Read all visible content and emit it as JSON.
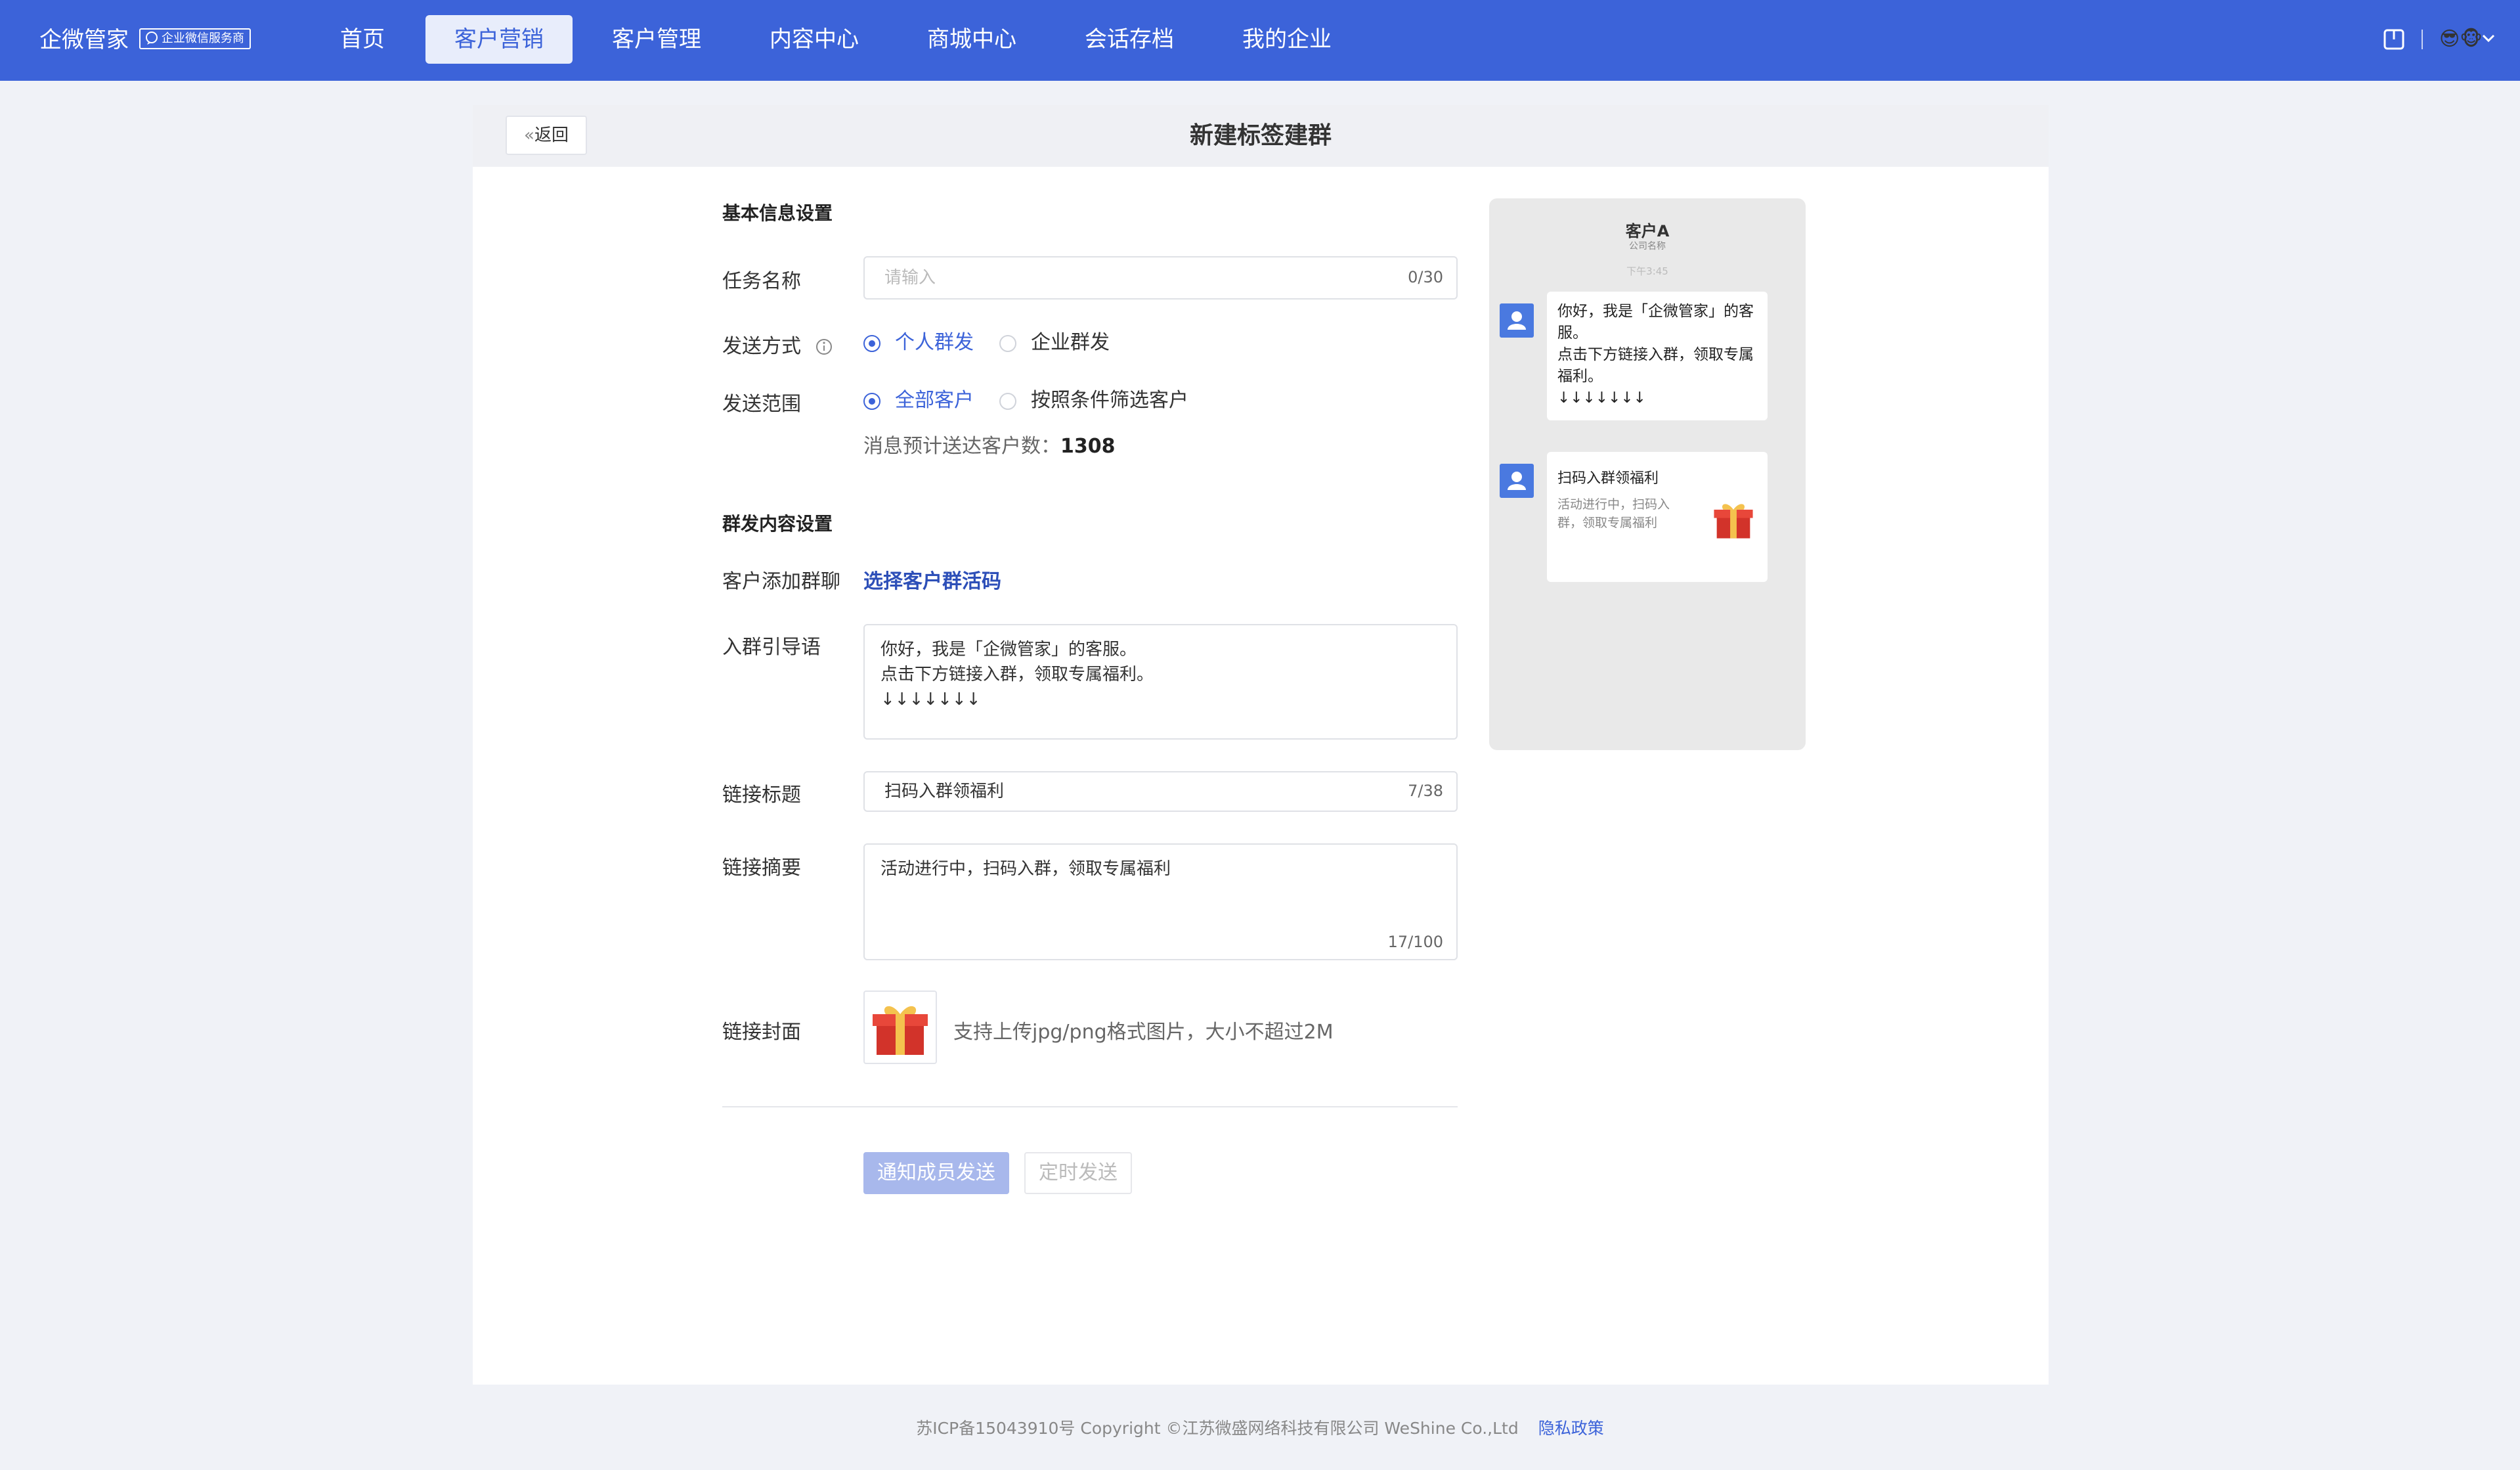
{
  "app": {
    "brand": "企微管家",
    "badge": "企业微信服务商"
  },
  "nav": {
    "items": [
      {
        "label": "首页"
      },
      {
        "label": "客户营销",
        "active": true
      },
      {
        "label": "客户管理"
      },
      {
        "label": "内容中心"
      },
      {
        "label": "商城中心"
      },
      {
        "label": "会话存档"
      },
      {
        "label": "我的企业"
      }
    ],
    "avatar": "😎🐵"
  },
  "header": {
    "back": "返回",
    "title": "新建标签建群"
  },
  "form": {
    "basic_title": "基本信息设置",
    "task_name": {
      "label": "任务名称",
      "placeholder": "请输入",
      "count": "0/30"
    },
    "send_method": {
      "label": "发送方式",
      "options": [
        "个人群发",
        "企业群发"
      ],
      "selected": 0
    },
    "send_range": {
      "label": "发送范围",
      "options": [
        "全部客户",
        "按照条件筛选客户"
      ],
      "selected": 0
    },
    "estimate": {
      "text": "消息预计送达客户数：",
      "value": "1308"
    },
    "content_title": "群发内容设置",
    "add_group": {
      "label": "客户添加群聊",
      "link": "选择客户群活码"
    },
    "guide": {
      "label": "入群引导语",
      "value": "你好，我是「企微管家」的客服。\n点击下方链接入群，领取专属福利。\n↓↓↓↓↓↓↓"
    },
    "link_title": {
      "label": "链接标题",
      "value": "扫码入群领福利",
      "count": "7/38"
    },
    "link_summary": {
      "label": "链接摘要",
      "value": "活动进行中，扫码入群，领取专属福利",
      "count": "17/100"
    },
    "link_cover": {
      "label": "链接封面",
      "hint": "支持上传jpg/png格式图片，大小不超过2M"
    },
    "buttons": {
      "primary": "通知成员发送",
      "secondary": "定时发送"
    }
  },
  "preview": {
    "name": "客户A",
    "company": "公司名称",
    "time": "下午3:45",
    "message": "你好，我是「企微管家」的客服。\n点击下方链接入群，领取专属福利。\n↓↓↓↓↓↓↓",
    "card_title": "扫码入群领福利",
    "card_desc": "活动进行中，扫码入群，领取专属福利"
  },
  "footer": {
    "text": "苏ICP备15043910号 Copyright ©江苏微盛网络科技有限公司 WeShine Co.,Ltd",
    "privacy": "隐私政策"
  },
  "colors": {
    "primary": "#3c63d9",
    "nav_bg": "#3c63d9",
    "page_bg": "#f0f2f7"
  },
  "icons": {
    "badge_icon": "chat-bubble-icon",
    "info_icon": "info-circle-icon",
    "notice_icon": "book-icon",
    "user_icon": "user-icon",
    "gift_icon": "gift-box-icon",
    "back_icon": "double-chevron-left-icon",
    "chevron_icon": "chevron-down-icon"
  }
}
